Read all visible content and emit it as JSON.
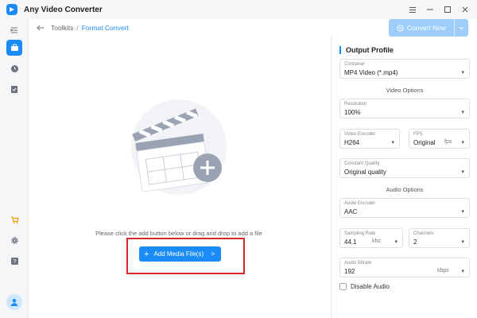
{
  "window": {
    "title": "Any Video Converter"
  },
  "header": {
    "breadcrumb": [
      "Toolkits",
      "Format Convert"
    ],
    "breadcrumb_sep": "/",
    "convert_label": "Convert Now"
  },
  "main": {
    "hint": "Please click the add button below or drag and drop to add a file",
    "add_label": "Add Media File(s)"
  },
  "panel": {
    "title": "Output Profile",
    "container": {
      "label": "Container",
      "value": "MP4 Video (*.mp4)"
    },
    "video_options": "Video Options",
    "resolution": {
      "label": "Resolution",
      "value": "100%"
    },
    "video_encoder": {
      "label": "Video Encoder",
      "value": "H264"
    },
    "fps": {
      "label": "FPS",
      "value": "Original",
      "unit": "fps"
    },
    "constant_quality": {
      "label": "Constant Quality",
      "value": "Original quality"
    },
    "audio_options": "Audio Options",
    "audio_encoder": {
      "label": "Audio Encoder",
      "value": "AAC"
    },
    "sampling_rate": {
      "label": "Sampling Rate",
      "value": "44.1",
      "unit": "khz"
    },
    "channels": {
      "label": "Channels",
      "value": "2"
    },
    "audio_bitrate": {
      "label": "Audio Bitrate",
      "value": "192",
      "unit": "kbps"
    },
    "disable_audio": "Disable Audio"
  },
  "colors": {
    "accent": "#1b8cf5",
    "highlight": "#d42a2a",
    "disabled_button": "#9ccdfb"
  }
}
